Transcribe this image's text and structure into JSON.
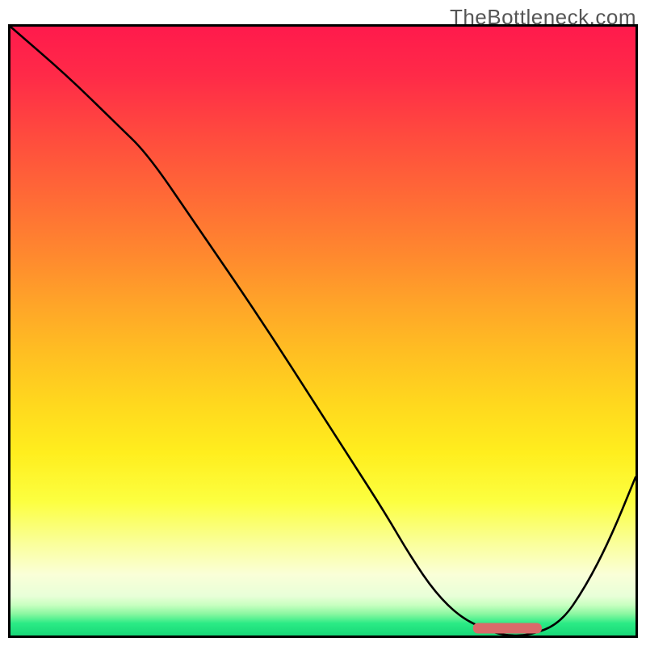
{
  "watermark": "TheBottleneck.com",
  "chart_data": {
    "type": "line",
    "title": "",
    "xlabel": "",
    "ylabel": "",
    "xlim": [
      0,
      100
    ],
    "ylim": [
      0,
      100
    ],
    "grid": false,
    "legend": "none",
    "series": [
      {
        "name": "bottleneck-curve",
        "x": [
          0,
          9,
          17,
          22,
          30,
          40,
          50,
          55,
          60,
          64,
          68,
          72,
          76,
          79,
          83,
          88,
          92,
          96,
          100
        ],
        "values": [
          100,
          92,
          84,
          79,
          67,
          52,
          36,
          28,
          20,
          13,
          7,
          3,
          1,
          0,
          0,
          2,
          8,
          16,
          26
        ]
      }
    ],
    "marker": {
      "x_start": 74,
      "x_end": 85,
      "y": 1.2,
      "color": "#d96a6a",
      "note": "optimal-range"
    },
    "background_gradient": {
      "top_color": "#ff1a4c",
      "mid_color": "#ffd81e",
      "bottom_color": "#18d878"
    }
  }
}
